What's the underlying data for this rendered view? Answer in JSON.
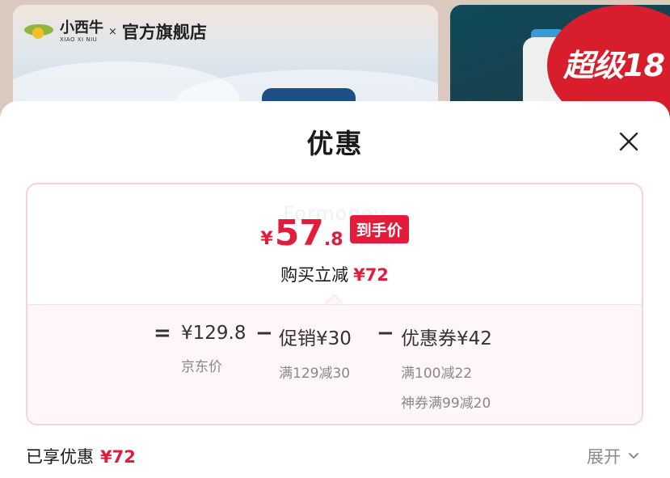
{
  "store": {
    "brand_cn": "小西牛",
    "brand_en": "XIAO XI NIU",
    "separator": "×",
    "store_name": "官方旗舰店",
    "promo_text": "超级18"
  },
  "sheet": {
    "title": "优惠",
    "watermark": "Formoney"
  },
  "price": {
    "currency": "¥",
    "integer": "57",
    "decimal": ".8",
    "badge": "到手价",
    "reduce_label": "购买立减",
    "reduce_amount": "¥72"
  },
  "breakdown": {
    "equals": "=",
    "minus": "−",
    "items": [
      {
        "main": "¥129.8",
        "sub": "京东价"
      },
      {
        "main": "促销¥30",
        "sub": "满129减30"
      },
      {
        "main": "优惠券¥42",
        "sub": "满100减22",
        "sub2": "神券满99减20"
      }
    ]
  },
  "footer": {
    "enjoyed_label": "已享优惠",
    "enjoyed_amount": "¥72",
    "expand_label": "展开"
  },
  "colors": {
    "accent": "#e21c3a",
    "card_border": "#f6d3dc",
    "breakdown_bg": "#fff6f7"
  }
}
